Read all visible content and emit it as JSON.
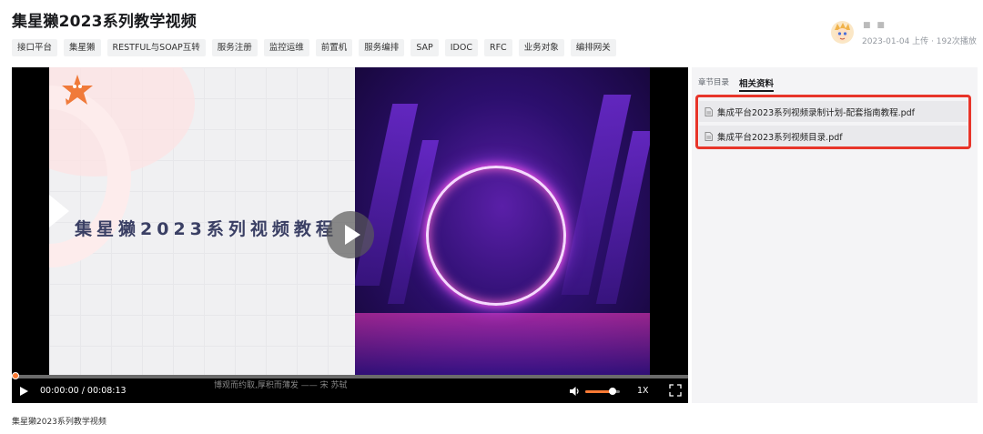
{
  "page": {
    "title": "集星獭2023系列教学视频",
    "caption": "集星獭2023系列教学视频"
  },
  "tags": [
    "接口平台",
    "集星獭",
    "RESTFUL与SOAP互转",
    "服务注册",
    "监控运维",
    "前置机",
    "服务编排",
    "SAP",
    "IDOC",
    "RFC",
    "业务对象",
    "编排网关"
  ],
  "uploader": {
    "name": "■ ■",
    "meta": "2023-01-04 上传 · 192次播放"
  },
  "player": {
    "slide_title": "集星獭2023系列视频教程",
    "subtitle_text": "博观而约取,厚积而薄发 —— 宋 苏轼",
    "current_time": "00:00:00",
    "separator": " / ",
    "duration": "00:08:13",
    "speed": "1X",
    "volume_level": 0.8,
    "progress_fraction": 0.0,
    "accent_color": "#fb7a34"
  },
  "side_panel": {
    "tabs": [
      {
        "label": "章节目录",
        "active": false
      },
      {
        "label": "相关资料",
        "active": true
      }
    ],
    "files": [
      {
        "name": "集成平台2023系列视频录制计划-配套指南教程.pdf",
        "icon": "document-icon"
      },
      {
        "name": "集成平台2023系列视频目录.pdf",
        "icon": "document-icon"
      }
    ],
    "highlight_color": "#e8352a"
  }
}
